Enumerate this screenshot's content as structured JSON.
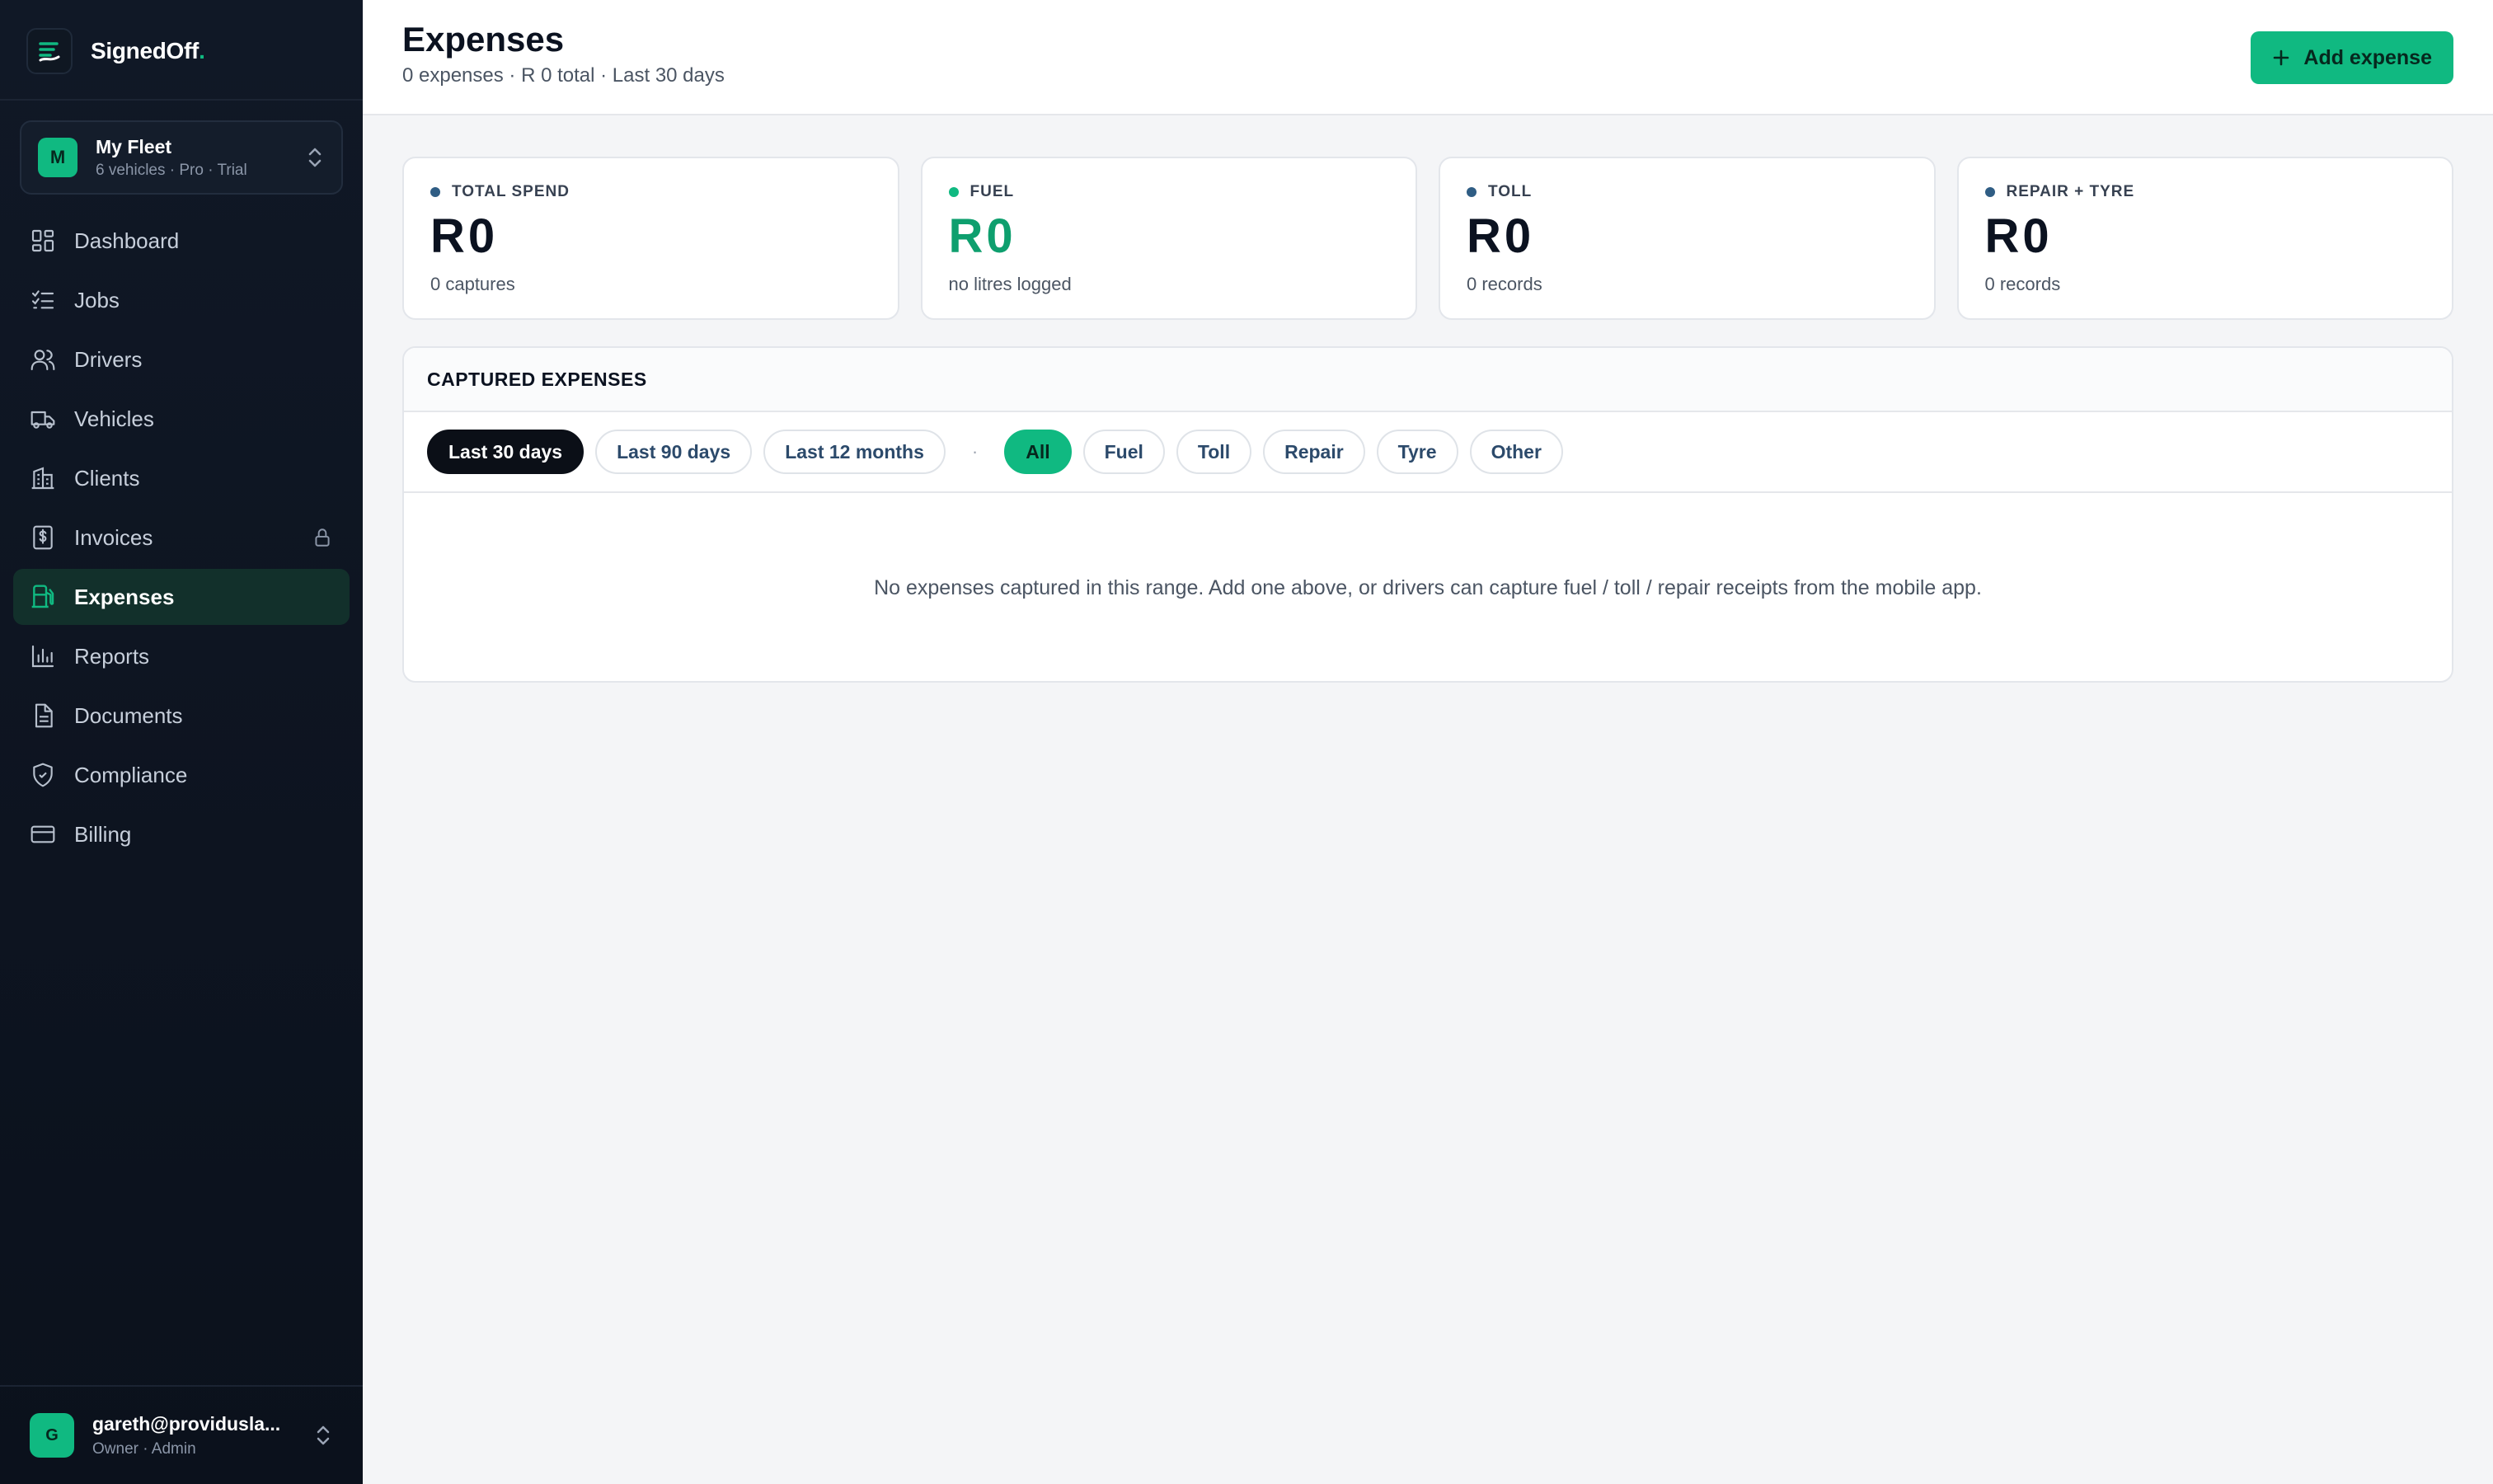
{
  "brand": {
    "name": "SignedOff",
    "dot": "."
  },
  "fleet": {
    "initial": "M",
    "name": "My Fleet",
    "subtitle": "6 vehicles · Pro · Trial"
  },
  "nav": [
    {
      "label": "Dashboard",
      "icon": "grid-icon"
    },
    {
      "label": "Jobs",
      "icon": "checklist-icon"
    },
    {
      "label": "Drivers",
      "icon": "users-icon"
    },
    {
      "label": "Vehicles",
      "icon": "truck-icon"
    },
    {
      "label": "Clients",
      "icon": "building-icon"
    },
    {
      "label": "Invoices",
      "icon": "dollar-doc-icon",
      "locked": true
    },
    {
      "label": "Expenses",
      "icon": "fuel-icon",
      "active": true
    },
    {
      "label": "Reports",
      "icon": "bar-chart-icon"
    },
    {
      "label": "Documents",
      "icon": "file-icon"
    },
    {
      "label": "Compliance",
      "icon": "shield-check-icon"
    },
    {
      "label": "Billing",
      "icon": "credit-card-icon"
    }
  ],
  "user": {
    "initial": "G",
    "email": "gareth@providusla...",
    "role": "Owner · Admin"
  },
  "header": {
    "title": "Expenses",
    "subtitle": "0 expenses · R 0 total · Last 30 days",
    "add_button": "Add expense"
  },
  "stats": [
    {
      "label": "TOTAL SPEND",
      "value": "R0",
      "sub": "0 captures",
      "accent": "#2f5d84"
    },
    {
      "label": "FUEL",
      "value": "R0",
      "sub": "no litres logged",
      "accent": "#10b981"
    },
    {
      "label": "TOLL",
      "value": "R0",
      "sub": "0 records",
      "accent": "#2f5d84"
    },
    {
      "label": "REPAIR + TYRE",
      "value": "R0",
      "sub": "0 records",
      "accent": "#2f5d84"
    }
  ],
  "captured": {
    "title": "CAPTURED EXPENSES",
    "ranges": [
      "Last 30 days",
      "Last 90 days",
      "Last 12 months"
    ],
    "selected_range": "Last 30 days",
    "separator": "·",
    "categories": [
      "All",
      "Fuel",
      "Toll",
      "Repair",
      "Tyre",
      "Other"
    ],
    "selected_category": "All",
    "empty_message": "No expenses captured in this range. Add one above, or drivers can capture fuel / toll / repair receipts from the mobile app."
  },
  "colors": {
    "accent": "#10b981",
    "sidebar": "#101826",
    "background": "#f4f5f7"
  }
}
